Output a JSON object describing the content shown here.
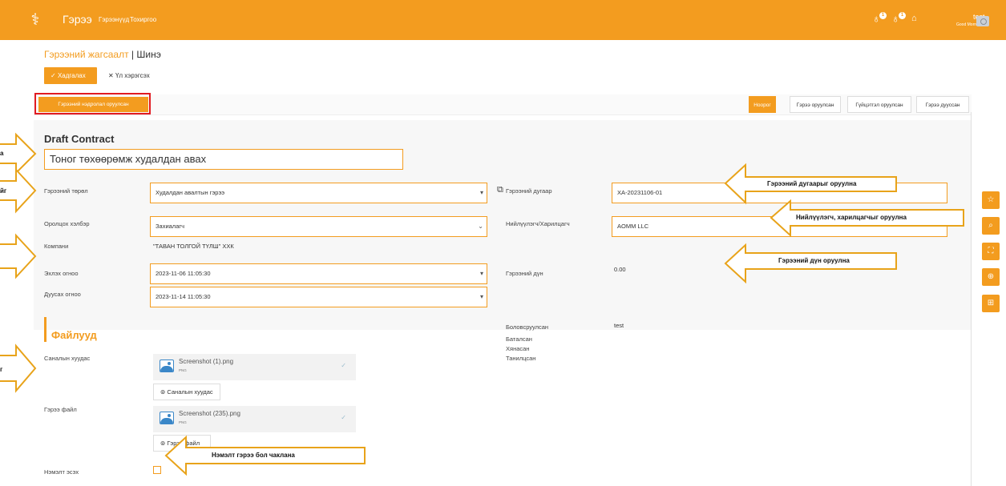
{
  "topbar": {
    "app_title": "Гэрээ",
    "nav": [
      "Гэрээнүүд",
      "Тохиргоо"
    ],
    "badges": [
      "1",
      "1"
    ],
    "user_name": "test",
    "greeting": "Good Morning",
    "icons": [
      "logo-wheat-icon",
      "bell-icon",
      "notification-icon",
      "home-icon",
      "camera-icon"
    ],
    "accent_color": "#f39c1f"
  },
  "breadcrumb": {
    "link": "Гэрээний жагсаалт",
    "separator": "|",
    "current": "Шинэ"
  },
  "toolbar": {
    "save_label": "Хадгалах",
    "cancel_label": "Үл хэрэгсэх"
  },
  "upload_button_label": "Гэрээний нэдролал оруулсан",
  "state_tabs": [
    {
      "label": "Ноорог",
      "active": true
    },
    {
      "label": "Гэрээ оруулсан",
      "active": false
    },
    {
      "label": "Гүйцэтгэл оруулсан",
      "active": false
    },
    {
      "label": "Гэрээ дууссан",
      "active": false
    }
  ],
  "form": {
    "draft_title": "Draft Contract",
    "contract_name": "Тоног төхөөрөмж худалдан авах",
    "fields": {
      "contract_type": {
        "label": "Гэрээний төрөл",
        "value": "Худалдан авалтын гэрээ"
      },
      "role": {
        "label": "Оролцох хэлбэр",
        "value": "Захиалагч"
      },
      "company": {
        "label": "Компани",
        "value": "\"ТАВАН ТОЛГОЙ ТҮЛШ\" ХХК"
      },
      "start_date": {
        "label": "Эхлэх огноо",
        "value": "2023-11-06 11:05:30"
      },
      "end_date": {
        "label": "Дуусах огноо",
        "value": "2023-11-14 11:05:30"
      },
      "contract_number": {
        "label": "Гэрээний дугаар",
        "value": "ХА-20231106-01"
      },
      "supplier": {
        "label": "Нийлүүлэгч/Харилцагч",
        "value": "AOMM LLC"
      },
      "amount": {
        "label": "Гэрээний дүн",
        "value": "0.00"
      }
    },
    "approvals": [
      {
        "label": "Боловсруулсан",
        "value": "test"
      },
      {
        "label": "Баталсан",
        "value": ""
      },
      {
        "label": "Хянасан",
        "value": ""
      },
      {
        "label": "Танилцсан",
        "value": ""
      }
    ]
  },
  "files": {
    "title": "Файлууд",
    "proposal": {
      "label": "Саналын хуудас",
      "file_name": "Screenshot (1).png",
      "file_type": "PNG",
      "attach_label": "Саналын хуудас"
    },
    "contract": {
      "label": "Гэрээ файл",
      "file_name": "Screenshot (235).png",
      "file_type": "PNG",
      "attach_label": "Гэрээ файл"
    },
    "additional_label": "Нэмэлт эсэх"
  },
  "side_toolbar": [
    "star-icon",
    "search-icon",
    "fullscreen-icon",
    "zoom-in-icon",
    "export-icon"
  ],
  "annotations": {
    "contract_number": "Гэрээний дугаарыг оруулна",
    "supplier": "Нийлүүлэгч, харилцагчыг оруулна",
    "amount": "Гэрээний дүн оруулна",
    "additional": "Нэмэлт гэрээ бол чаклана",
    "left_fragments": [
      "а",
      "йг",
      "",
      "",
      "г"
    ]
  }
}
